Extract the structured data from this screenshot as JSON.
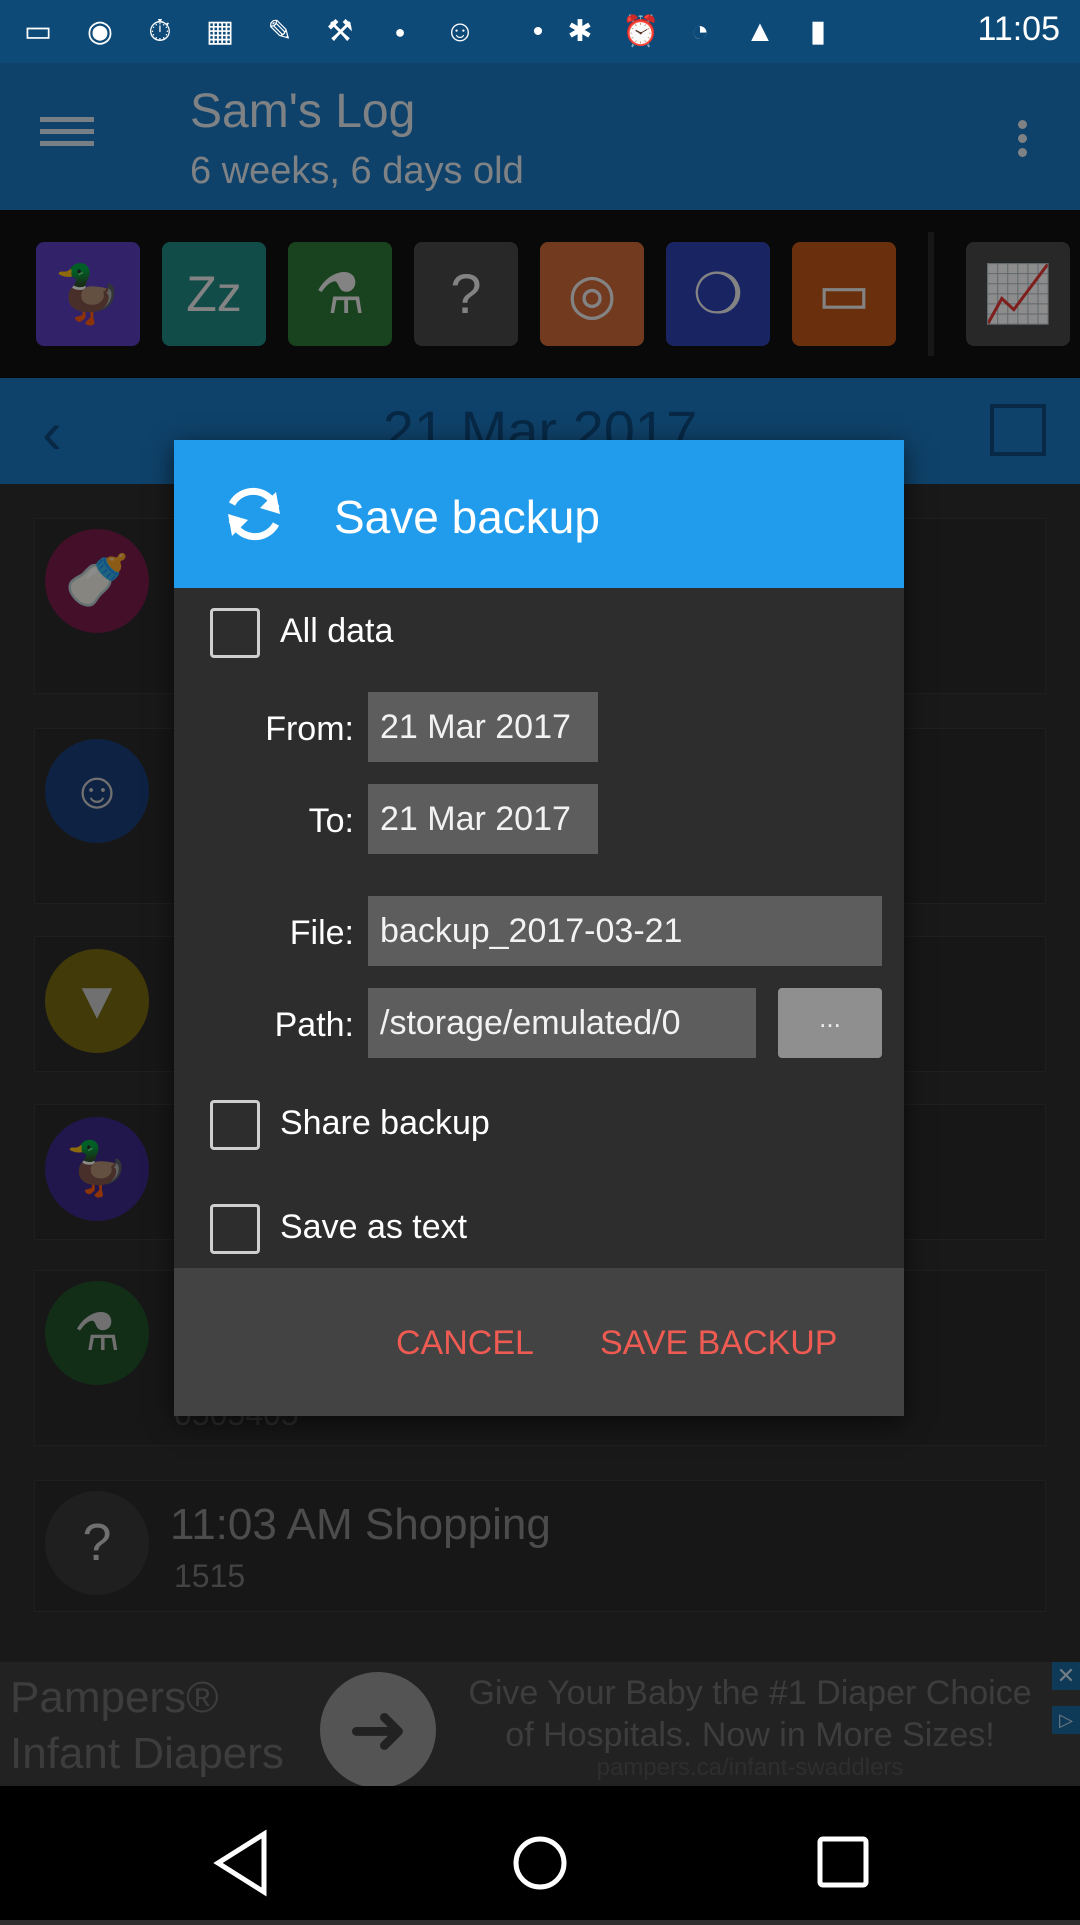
{
  "status_bar": {
    "time": "11:05",
    "icons": [
      "messages-icon",
      "camera-icon",
      "timer-icon",
      "calendar-icon",
      "wrench-icon",
      "shovel-icon",
      "fox-sports-icon",
      "smiley-icon",
      "bluetooth-icon",
      "alarm-icon",
      "wifi-icon",
      "signal-icon"
    ]
  },
  "app_header": {
    "title": "Sam's Log",
    "subtitle": "6 weeks, 6 days old"
  },
  "categories": [
    {
      "name": "feeding-duck",
      "color": "#5a3fbf",
      "glyph": "🦆"
    },
    {
      "name": "sleep",
      "color": "#1f8a86",
      "glyph": "Zz"
    },
    {
      "name": "medicine",
      "color": "#2f7a3a",
      "glyph": "💊"
    },
    {
      "name": "other",
      "color": "#4a4a4a",
      "glyph": "?"
    },
    {
      "name": "bib",
      "color": "#d06a3a",
      "glyph": "◎"
    },
    {
      "name": "tummy",
      "color": "#2f44b4",
      "glyph": "❍"
    },
    {
      "name": "growth",
      "color": "#c25818",
      "glyph": "📏"
    },
    {
      "name": "chart",
      "color": "#4a4a4a",
      "glyph": "📈"
    }
  ],
  "date_nav": {
    "date": "21 Mar 2017"
  },
  "list": {
    "partial_text": "0505405",
    "item_title": "11:03 AM Shopping",
    "item_sub": "1515"
  },
  "ad": {
    "left_text_1": "Pampers®",
    "left_text_2": "Infant Diapers",
    "right_text_1": "Give Your Baby the #1 Diaper Choice",
    "right_text_2": "of Hospitals. Now in More Sizes!",
    "url": "pampers.ca/infant-swaddlers"
  },
  "dialog": {
    "title": "Save backup",
    "all_data_label": "All data",
    "from_label": "From:",
    "from_value": "21 Mar 2017",
    "to_label": "To:",
    "to_value": "21 Mar 2017",
    "file_label": "File:",
    "file_value": "backup_2017-03-21",
    "path_label": "Path:",
    "path_value": "/storage/emulated/0",
    "browse_label": "...",
    "share_label": "Share backup",
    "save_text_label": "Save as text",
    "cancel_label": "CANCEL",
    "save_label": "SAVE BACKUP"
  }
}
